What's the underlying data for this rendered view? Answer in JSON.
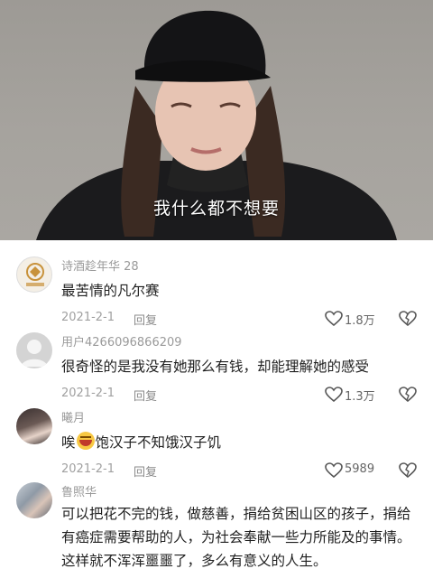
{
  "video": {
    "subtitle": "我什么都不想要"
  },
  "comments": [
    {
      "username": "诗酒趁年华 28",
      "text": "最苦情的凡尔赛",
      "date": "2021-2-1",
      "reply_label": "回复",
      "likes": "1.8万",
      "avatar": "badge-avatar"
    },
    {
      "username": "用户4266096866209",
      "text": "很奇怪的是我没有她那么有钱，却能理解她的感受",
      "date": "2021-2-1",
      "reply_label": "回复",
      "likes": "1.3万",
      "avatar": "default-user-avatar"
    },
    {
      "username": "曦月",
      "text_before": "唉",
      "emoji": "laughing-crying-emoji",
      "text_after": "饱汉子不知饿汉子饥",
      "date": "2021-2-1",
      "reply_label": "回复",
      "likes": "5989",
      "avatar": "photo-avatar"
    },
    {
      "username": "鲁照华",
      "text": "可以把花不完的钱，做慈善，捐给贫困山区的孩子，捐给有癌症需要帮助的人，为社会奉献一些力所能及的事情。这样就不浑浑噩噩了，多么有意义的人生。",
      "avatar": "photo-avatar"
    }
  ],
  "colors": {
    "username": "#9a9a9a",
    "text": "#1f1f1f",
    "meta": "#a0a0a0"
  }
}
